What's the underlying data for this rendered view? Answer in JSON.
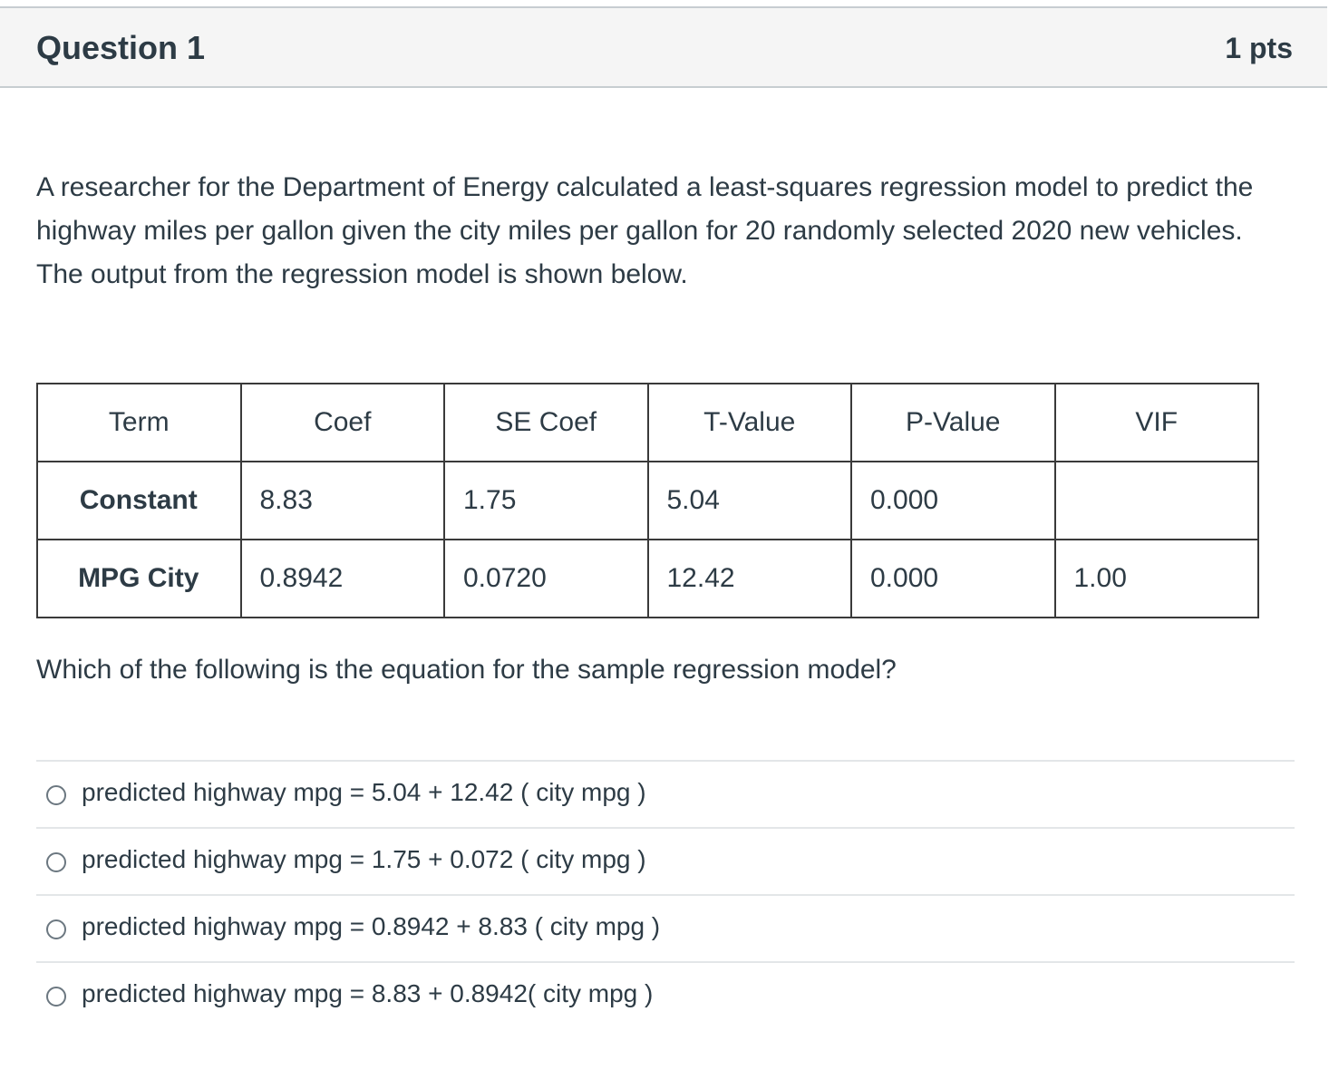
{
  "question": {
    "title": "Question 1",
    "points": "1 pts",
    "text": "A researcher for the Department of Energy calculated a least-squares regression model to predict the highway miles per gallon given the city miles per gallon for 20 randomly selected 2020 new vehicles.  The output from the regression model is shown below.",
    "prompt": "Which of the following is the equation for the sample regression model?"
  },
  "table": {
    "headers": [
      "Term",
      "Coef",
      "SE Coef",
      "T-Value",
      "P-Value",
      "VIF"
    ],
    "rows": [
      [
        "Constant",
        "8.83",
        "1.75",
        "5.04",
        "0.000",
        ""
      ],
      [
        "MPG City",
        "0.8942",
        "0.0720",
        "12.42",
        "0.000",
        "1.00"
      ]
    ]
  },
  "answers": [
    {
      "label": "predicted highway mpg = 5.04 + 12.42 ( city mpg )"
    },
    {
      "label": "predicted highway mpg = 1.75 + 0.072 ( city mpg )"
    },
    {
      "label": "predicted highway mpg = 0.8942 + 8.83 ( city mpg )"
    },
    {
      "label": "predicted highway mpg = 8.83 + 0.8942( city mpg )"
    }
  ]
}
